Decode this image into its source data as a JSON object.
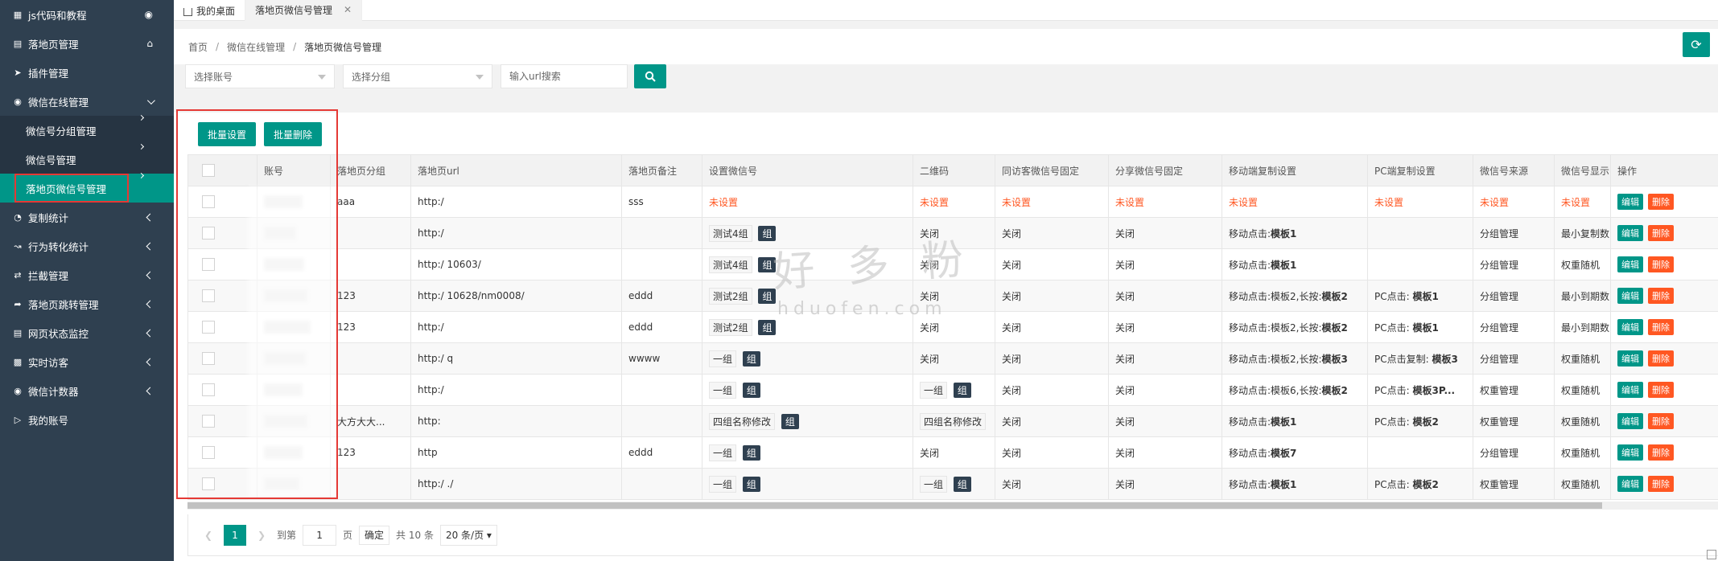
{
  "sidebar": {
    "items": [
      {
        "label": "js代码和教程",
        "icon": "code-icon",
        "right": "eye-icon"
      },
      {
        "label": "落地页管理",
        "icon": "file-icon",
        "right": "home-icon"
      },
      {
        "label": "插件管理",
        "icon": "send-icon"
      },
      {
        "label": "微信在线管理",
        "icon": "wechat-icon",
        "right": "chevron-down-icon"
      }
    ],
    "sub_items": [
      {
        "label": "微信号分组管理"
      },
      {
        "label": "微信号管理"
      },
      {
        "label": "落地页微信号管理",
        "active": true
      }
    ],
    "bottom_items": [
      {
        "label": "复制统计",
        "icon": "pie-icon"
      },
      {
        "label": "行为转化统计",
        "icon": "line-chart-icon"
      },
      {
        "label": "拦截管理",
        "icon": "exchange-icon"
      },
      {
        "label": "落地页跳转管理",
        "icon": "share-icon"
      },
      {
        "label": "网页状态监控",
        "icon": "monitor-icon"
      },
      {
        "label": "实时访客",
        "icon": "bar-chart-icon"
      },
      {
        "label": "微信计数器",
        "icon": "wechat-icon"
      },
      {
        "label": "我的账号",
        "icon": "lock-icon"
      }
    ]
  },
  "tabs": [
    {
      "label": "我的桌面"
    },
    {
      "label": "落地页微信号管理",
      "active": true
    }
  ],
  "breadcrumb": [
    "首页",
    "微信在线管理",
    "落地页微信号管理"
  ],
  "filters": {
    "account_placeholder": "选择账号",
    "group_placeholder": "选择分组",
    "url_placeholder": "输入url搜索"
  },
  "toolbar": {
    "batch_set": "批量设置",
    "batch_delete": "批量删除"
  },
  "table": {
    "headers": [
      "",
      "账号",
      "落地页分组",
      "落地页url",
      "落地页备注",
      "设置微信号",
      "二维码",
      "同访客微信号固定",
      "分享微信号固定",
      "移动端复制设置",
      "PC端复制设置",
      "微信号来源",
      "微信号显示",
      "操作"
    ],
    "rows": [
      {
        "group": "aaa",
        "url": "http:/",
        "note": "sss",
        "wx": "未设置",
        "wx_badge": "",
        "qr": "未设置",
        "qr_badge": "",
        "fixed": "未设置",
        "share": "未设置",
        "mobile": "未设置",
        "mobile_tpl": "",
        "pc": "未设置",
        "pc_tpl": "",
        "source": "未设置",
        "display": "未设置",
        "unset": true
      },
      {
        "group": "",
        "url": "http:/",
        "note": "",
        "wx": "测试4组",
        "wx_badge": "组",
        "qr": "关闭",
        "qr_badge": "",
        "fixed": "关闭",
        "share": "关闭",
        "mobile": "移动点击:",
        "mobile_tpl": "模板1",
        "pc": "",
        "pc_tpl": "",
        "source": "分组管理",
        "display": "最小复制数"
      },
      {
        "group": "",
        "url": "http:/                        10603/",
        "note": "",
        "wx": "测试4组",
        "wx_badge": "组",
        "qr": "关闭",
        "qr_badge": "",
        "fixed": "关闭",
        "share": "关闭",
        "mobile": "移动点击:",
        "mobile_tpl": "模板1",
        "pc": "",
        "pc_tpl": "",
        "source": "分组管理",
        "display": "权重随机"
      },
      {
        "group": "123",
        "url": "http:/                        10628/nm0008/",
        "note": "eddd",
        "wx": "测试2组",
        "wx_badge": "组",
        "qr": "关闭",
        "qr_badge": "",
        "fixed": "关闭",
        "share": "关闭",
        "mobile": "移动点击:模板2,长按:",
        "mobile_tpl": "模板2",
        "pc": "PC点击:",
        "pc_tpl": "模板1",
        "source": "分组管理",
        "display": "最小到期数"
      },
      {
        "group": "123",
        "url": "http:/",
        "note": "eddd",
        "wx": "测试2组",
        "wx_badge": "组",
        "qr": "关闭",
        "qr_badge": "",
        "fixed": "关闭",
        "share": "关闭",
        "mobile": "移动点击:模板2,长按:",
        "mobile_tpl": "模板2",
        "pc": "PC点击:",
        "pc_tpl": "模板1",
        "source": "分组管理",
        "display": "最小到期数"
      },
      {
        "group": "",
        "url": "http:/                      q",
        "note": "wwww",
        "wx": "一组",
        "wx_badge": "组",
        "qr": "关闭",
        "qr_badge": "",
        "fixed": "关闭",
        "share": "关闭",
        "mobile": "移动点击:模板2,长按:",
        "mobile_tpl": "模板3",
        "pc": "PC点击复制:",
        "pc_tpl": "模板3",
        "source": "分组管理",
        "display": "权重随机"
      },
      {
        "group": "",
        "url": "http:/",
        "note": "",
        "wx": "一组",
        "wx_badge": "组",
        "qr": "一组",
        "qr_badge": "组",
        "fixed": "关闭",
        "share": "关闭",
        "mobile": "移动点击:模板6,长按:",
        "mobile_tpl": "模板2",
        "pc": "PC点击:",
        "pc_tpl": "模板3P...",
        "source": "权重管理",
        "display": "权重随机"
      },
      {
        "group": "大方大大...",
        "url": "http:",
        "note": "",
        "wx": "四组名称修改",
        "wx_badge": "组",
        "qr": "四组名称修改",
        "qr_badge": "",
        "fixed": "关闭",
        "share": "关闭",
        "mobile": "移动点击:",
        "mobile_tpl": "模板1",
        "pc": "PC点击:",
        "pc_tpl": "模板2",
        "source": "权重管理",
        "display": "权重随机"
      },
      {
        "group": "123",
        "url": "http",
        "note": "eddd",
        "wx": "一组",
        "wx_badge": "组",
        "qr": "关闭",
        "qr_badge": "",
        "fixed": "关闭",
        "share": "关闭",
        "mobile": "移动点击:",
        "mobile_tpl": "模板7",
        "pc": "",
        "pc_tpl": "",
        "source": "分组管理",
        "display": "权重随机"
      },
      {
        "group": "",
        "url": "http:/                      ./",
        "note": "",
        "wx": "一组",
        "wx_badge": "组",
        "qr": "一组",
        "qr_badge": "组",
        "fixed": "关闭",
        "share": "关闭",
        "mobile": "移动点击:",
        "mobile_tpl": "模板1",
        "pc": "PC点击:",
        "pc_tpl": "模板2",
        "source": "权重管理",
        "display": "权重随机"
      }
    ],
    "edit_label": "编辑",
    "delete_label": "删除"
  },
  "pager": {
    "current": "1",
    "goto_label": "到第",
    "goto_value": "1",
    "page_unit": "页",
    "ok": "确定",
    "total": "共 10 条",
    "size": "20 条/页"
  },
  "watermark": {
    "cn": "好 多 粉",
    "en": "hduofen.com"
  },
  "colors": {
    "sidebar": "#2f4050",
    "accent": "#009688",
    "danger": "#ff5722",
    "highlight_box": "#e53935"
  }
}
